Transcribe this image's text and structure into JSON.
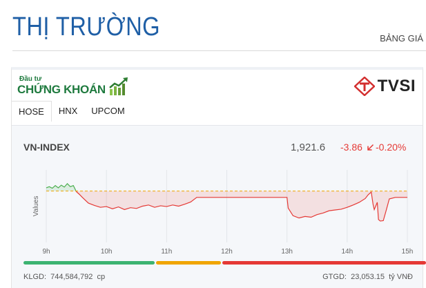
{
  "header": {
    "title": "THỊ TRƯỜNG",
    "price_board_link": "BẢNG GIÁ"
  },
  "brand": {
    "small": "Đầu tư",
    "big": "CHỨNG KHOÁN",
    "partner": "TVSI"
  },
  "tabs": [
    {
      "label": "HOSE",
      "active": true
    },
    {
      "label": "HNX"
    },
    {
      "label": "UPCOM"
    }
  ],
  "index": {
    "name": "VN-INDEX",
    "value": "1,921.6",
    "change": "-3.86",
    "change_icon": "arrow-down-left-icon",
    "percent": "-0.20%"
  },
  "breadth": {
    "up_color": "#3cb371",
    "flat_color": "#f0a500",
    "down_color": "#e53935",
    "up_fraction": 0.33,
    "flat_fraction": 0.165,
    "down_fraction": 0.505
  },
  "footer": {
    "volume_label": "KLGD:",
    "volume_value": "744,584,792",
    "volume_unit": "cp",
    "value_label": "GTGD:",
    "value_value": "23,053.15",
    "value_unit": "tỷ VNĐ"
  },
  "chart_data": {
    "type": "line",
    "ylabel": "Values",
    "x_ticks": [
      "9h",
      "10h",
      "11h",
      "12h",
      "13h",
      "14h",
      "15h"
    ],
    "reference": 1925.46,
    "ylim": [
      1912,
      1931
    ],
    "grid": true,
    "up_color": "#4caf50",
    "down_color": "#e53935",
    "points": [
      [
        9.0,
        1926.3
      ],
      [
        9.05,
        1926.6
      ],
      [
        9.1,
        1926.2
      ],
      [
        9.15,
        1926.9
      ],
      [
        9.2,
        1926.3
      ],
      [
        9.25,
        1927.0
      ],
      [
        9.3,
        1926.5
      ],
      [
        9.35,
        1927.4
      ],
      [
        9.4,
        1926.6
      ],
      [
        9.45,
        1926.9
      ],
      [
        9.5,
        1925.3
      ],
      [
        9.55,
        1924.6
      ],
      [
        9.6,
        1923.8
      ],
      [
        9.7,
        1922.3
      ],
      [
        9.8,
        1921.7
      ],
      [
        9.9,
        1921.2
      ],
      [
        10.0,
        1921.4
      ],
      [
        10.1,
        1920.8
      ],
      [
        10.2,
        1921.3
      ],
      [
        10.3,
        1920.6
      ],
      [
        10.4,
        1921.1
      ],
      [
        10.5,
        1920.9
      ],
      [
        10.6,
        1921.5
      ],
      [
        10.7,
        1921.8
      ],
      [
        10.8,
        1921.2
      ],
      [
        10.9,
        1921.6
      ],
      [
        11.0,
        1921.4
      ],
      [
        11.1,
        1921.8
      ],
      [
        11.2,
        1921.5
      ],
      [
        11.3,
        1922.0
      ],
      [
        11.4,
        1922.6
      ],
      [
        11.5,
        1923.8
      ],
      [
        12.0,
        1923.8
      ],
      [
        12.5,
        1923.8
      ],
      [
        13.0,
        1923.8
      ],
      [
        13.02,
        1921.0
      ],
      [
        13.1,
        1919.0
      ],
      [
        13.2,
        1918.4
      ],
      [
        13.3,
        1918.8
      ],
      [
        13.4,
        1918.6
      ],
      [
        13.5,
        1919.3
      ],
      [
        13.6,
        1919.7
      ],
      [
        13.7,
        1920.3
      ],
      [
        13.8,
        1920.5
      ],
      [
        13.9,
        1920.7
      ],
      [
        14.0,
        1921.2
      ],
      [
        14.1,
        1921.8
      ],
      [
        14.2,
        1922.5
      ],
      [
        14.3,
        1923.5
      ],
      [
        14.35,
        1924.5
      ],
      [
        14.4,
        1925.2
      ],
      [
        14.43,
        1922.0
      ],
      [
        14.45,
        1920.6
      ],
      [
        14.5,
        1922.5
      ],
      [
        14.52,
        1918.0
      ],
      [
        14.55,
        1917.6
      ],
      [
        14.6,
        1917.7
      ],
      [
        14.65,
        1920.5
      ],
      [
        14.7,
        1923.4
      ],
      [
        14.8,
        1923.8
      ],
      [
        15.0,
        1923.8
      ]
    ]
  }
}
